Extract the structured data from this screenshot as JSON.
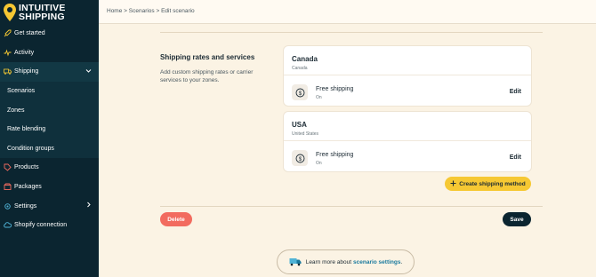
{
  "brand": {
    "line1": "INTUITIVE",
    "line2": "SHIPPING"
  },
  "sidebar": {
    "items": [
      {
        "label": "Get started",
        "icon": "rocket-icon"
      },
      {
        "label": "Activity",
        "icon": "activity-icon"
      },
      {
        "label": "Shipping",
        "icon": "truck-icon"
      },
      {
        "label": "Scenarios"
      },
      {
        "label": "Zones"
      },
      {
        "label": "Rate blending"
      },
      {
        "label": "Condition groups"
      },
      {
        "label": "Products",
        "icon": "tag-icon"
      },
      {
        "label": "Packages",
        "icon": "box-icon"
      },
      {
        "label": "Settings",
        "icon": "gear-icon"
      },
      {
        "label": "Shopify connection",
        "icon": "cloud-icon"
      }
    ]
  },
  "breadcrumb": {
    "home": "Home",
    "scenarios": "Scenarios",
    "current": "Edit scenario",
    "sep": ">"
  },
  "section": {
    "title": "Shipping rates and services",
    "description": "Add custom shipping rates or carrier services to your zones."
  },
  "zones": [
    {
      "name": "Canada",
      "country": "Canada",
      "service": "Free shipping",
      "status": "On",
      "edit": "Edit"
    },
    {
      "name": "USA",
      "country": "United States",
      "service": "Free shipping",
      "status": "On",
      "edit": "Edit"
    }
  ],
  "actions": {
    "create": "Create shipping method",
    "delete": "Delete",
    "save": "Save"
  },
  "learn": {
    "prefix": "Learn more about",
    "link": "scenario settings",
    "suffix": "."
  },
  "colors": {
    "sidebar": "#0b2530",
    "accent": "#f6c833",
    "danger": "#f26b5f",
    "background": "#fbf3e4",
    "link": "#1a7a9e"
  }
}
